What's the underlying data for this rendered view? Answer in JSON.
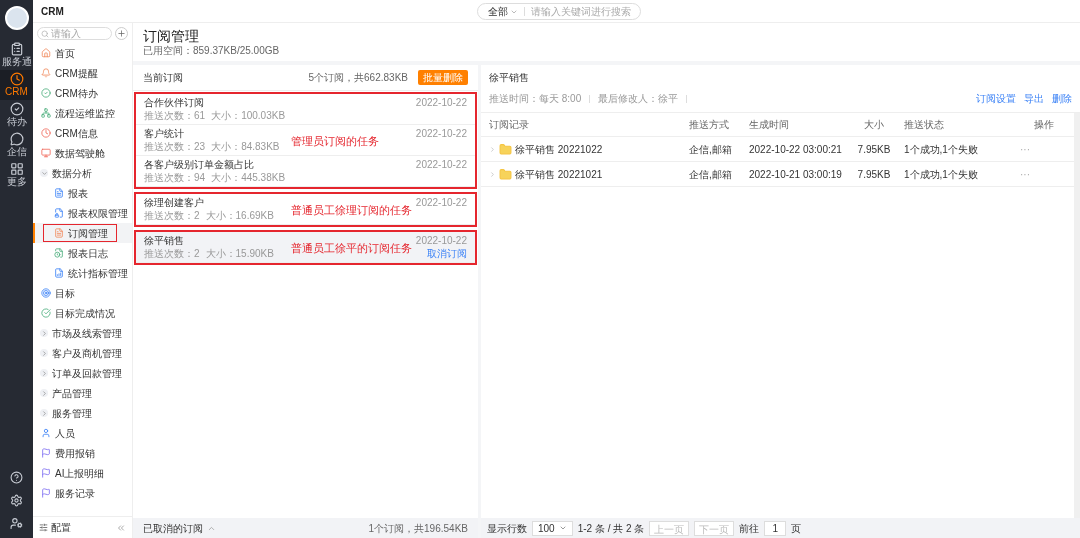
{
  "rail": {
    "items": [
      {
        "label": "服务通",
        "selected": false
      },
      {
        "label": "CRM",
        "selected": true
      },
      {
        "label": "待办",
        "selected": false
      },
      {
        "label": "企信",
        "selected": false
      },
      {
        "label": "更多",
        "selected": false
      }
    ]
  },
  "app_title": "CRM",
  "search": {
    "scope": "全部",
    "placeholder": "请输入关键词进行搜索"
  },
  "sidebar": {
    "search_placeholder": "请输入",
    "footer": "配置",
    "items": [
      {
        "kind": "link",
        "label": "首页",
        "selected": false
      },
      {
        "kind": "link",
        "label": "CRM提醒",
        "selected": false
      },
      {
        "kind": "link",
        "label": "CRM待办",
        "selected": false
      },
      {
        "kind": "link",
        "label": "流程运维监控",
        "selected": false
      },
      {
        "kind": "link",
        "label": "CRM信息",
        "selected": false
      },
      {
        "kind": "link",
        "label": "数据驾驶舱",
        "selected": false
      },
      {
        "kind": "group",
        "label": "数据分析",
        "expanded": true,
        "children": [
          {
            "kind": "link",
            "label": "报表",
            "selected": false
          },
          {
            "kind": "link",
            "label": "报表权限管理",
            "selected": false
          },
          {
            "kind": "link",
            "label": "订阅管理",
            "selected": true,
            "annotated": true
          },
          {
            "kind": "link",
            "label": "报表日志",
            "selected": false
          },
          {
            "kind": "link",
            "label": "统计指标管理",
            "selected": false
          }
        ]
      },
      {
        "kind": "link",
        "label": "目标",
        "selected": false
      },
      {
        "kind": "link",
        "label": "目标完成情况",
        "selected": false
      },
      {
        "kind": "group",
        "label": "市场及线索管理",
        "expanded": false
      },
      {
        "kind": "group",
        "label": "客户及商机管理",
        "expanded": false
      },
      {
        "kind": "group",
        "label": "订单及回款管理",
        "expanded": false
      },
      {
        "kind": "group",
        "label": "产品管理",
        "expanded": false
      },
      {
        "kind": "group",
        "label": "服务管理",
        "expanded": false
      },
      {
        "kind": "link",
        "label": "人员",
        "selected": false
      },
      {
        "kind": "link",
        "label": "费用报销",
        "selected": false
      },
      {
        "kind": "link",
        "label": "AI上报明细",
        "selected": false
      },
      {
        "kind": "link",
        "label": "服务记录",
        "selected": false
      }
    ]
  },
  "page": {
    "title": "订阅管理",
    "usage": "已用空间：859.37KB/25.00GB"
  },
  "current": {
    "title": "当前订阅",
    "summary": "5个订阅，共662.83KB",
    "batch_delete": "批量删除",
    "groups": [
      {
        "annotation": "管理员订阅的任务",
        "items": [
          {
            "name": "合作伙伴订阅",
            "count": "推送次数：61",
            "size": "大小：100.03KB",
            "date": "2022-10-22",
            "selected": false
          },
          {
            "name": "客户统计",
            "count": "推送次数：23",
            "size": "大小：84.83KB",
            "date": "2022-10-22",
            "selected": false
          },
          {
            "name": "各客户级别订单金额占比",
            "count": "推送次数：94",
            "size": "大小：445.38KB",
            "date": "2022-10-22",
            "selected": false
          }
        ]
      },
      {
        "annotation": "普通员工徐理订阅的任务",
        "items": [
          {
            "name": "徐理创建客户",
            "count": "推送次数：2",
            "size": "大小：16.69KB",
            "date": "2022-10-22",
            "selected": false
          }
        ]
      },
      {
        "annotation": "普通员工徐平的订阅任务",
        "items": [
          {
            "name": "徐平销售",
            "count": "推送次数：2",
            "size": "大小：15.90KB",
            "date": "2022-10-22",
            "selected": true,
            "cancel": "取消订阅"
          }
        ]
      }
    ]
  },
  "cancelled": {
    "title": "已取消的订阅",
    "expanded": false,
    "summary": "1个订阅，共196.54KB"
  },
  "detail": {
    "title": "徐平销售",
    "push_time": "推送时间：每天 8:00",
    "modifier": "最后修改人：徐平",
    "actions": [
      "订阅设置",
      "导出",
      "删除"
    ],
    "columns": [
      "订阅记录",
      "推送方式",
      "生成时间",
      "大小",
      "推送状态",
      "操作"
    ],
    "rows": [
      {
        "name": "徐平销售 20221022",
        "method": "企信,邮箱",
        "time": "2022-10-22 03:00:21",
        "size": "7.95KB",
        "status": "1个成功,1个失败",
        "op": "···"
      },
      {
        "name": "徐平销售 20221021",
        "method": "企信,邮箱",
        "time": "2022-10-21 03:00:19",
        "size": "7.95KB",
        "status": "1个成功,1个失败",
        "op": "···"
      }
    ]
  },
  "pagination": {
    "rows_label": "显示行数",
    "rows_value": "100",
    "range": "1-2 条 / 共 2 条",
    "prev": "上一页",
    "next": "下一页",
    "goto": "前往",
    "page": "1",
    "page_unit": "页"
  }
}
